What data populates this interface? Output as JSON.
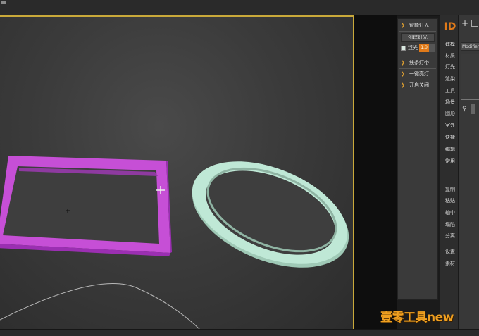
{
  "plugin_panel": {
    "items": [
      {
        "label": "智能灯光"
      },
      {
        "label": "创建灯光"
      },
      {
        "label": "泛光"
      },
      {
        "label": "线条灯带"
      },
      {
        "label": "一键亮灯"
      },
      {
        "label": "开启关闭"
      }
    ],
    "value": "1.0"
  },
  "side_menu": {
    "items": [
      "建模",
      "材质",
      "灯光",
      "渲染",
      "工具",
      "场景",
      "图形",
      "室外",
      "快捷",
      "编辑",
      "常用",
      "复制",
      "粘贴",
      "轴中",
      "塌陷",
      "分离",
      "设置",
      "素材"
    ]
  },
  "command_panel": {
    "modifier_list": "Modifier List"
  },
  "watermark": "壹零工具new",
  "colors": {
    "accent": "#e07a1a",
    "viewport_border": "#c9a93a",
    "frame_object": "#c64fd6",
    "ring_object": "#bfe8d6"
  }
}
